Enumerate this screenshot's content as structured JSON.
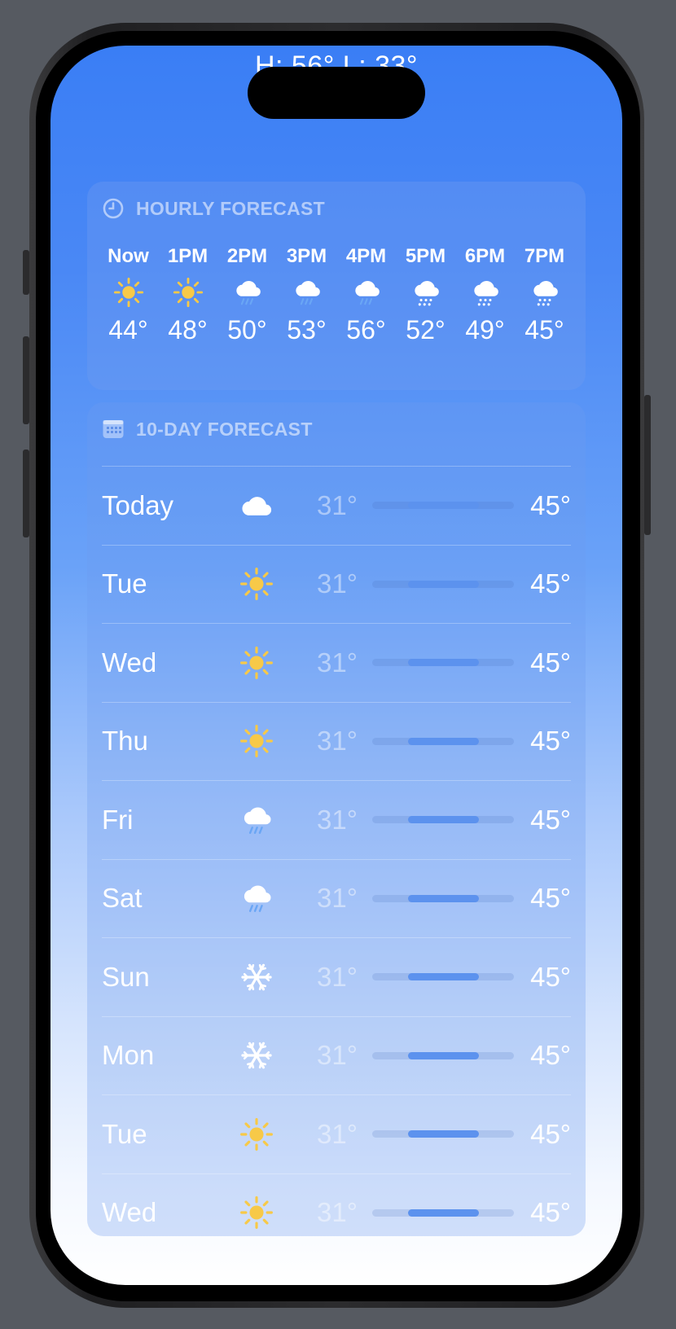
{
  "header": {
    "hi_lo_text": "H: 56°  L: 33°"
  },
  "hourly": {
    "title": "HOURLY FORECAST",
    "items": [
      {
        "time": "Now",
        "icon": "sun-icon",
        "temp": "44°"
      },
      {
        "time": "1PM",
        "icon": "sun-icon",
        "temp": "48°"
      },
      {
        "time": "2PM",
        "icon": "cloud-rain-icon",
        "temp": "50°"
      },
      {
        "time": "3PM",
        "icon": "cloud-rain-icon",
        "temp": "53°"
      },
      {
        "time": "4PM",
        "icon": "cloud-rain-icon",
        "temp": "56°"
      },
      {
        "time": "5PM",
        "icon": "cloud-snow-icon",
        "temp": "52°"
      },
      {
        "time": "6PM",
        "icon": "cloud-snow-icon",
        "temp": "49°"
      },
      {
        "time": "7PM",
        "icon": "cloud-snow-icon",
        "temp": "45°"
      }
    ]
  },
  "daily": {
    "title": "10-DAY FORECAST",
    "range_fill": {
      "start": 0.25,
      "end": 0.75
    },
    "items": [
      {
        "day": "Today",
        "icon": "cloud-icon",
        "low": "31°",
        "high": "45°"
      },
      {
        "day": "Tue",
        "icon": "sun-icon",
        "low": "31°",
        "high": "45°"
      },
      {
        "day": "Wed",
        "icon": "sun-icon",
        "low": "31°",
        "high": "45°"
      },
      {
        "day": "Thu",
        "icon": "sun-icon",
        "low": "31°",
        "high": "45°"
      },
      {
        "day": "Fri",
        "icon": "cloud-rain-icon",
        "low": "31°",
        "high": "45°"
      },
      {
        "day": "Sat",
        "icon": "cloud-rain-icon",
        "low": "31°",
        "high": "45°"
      },
      {
        "day": "Sun",
        "icon": "snowflake-icon",
        "low": "31°",
        "high": "45°"
      },
      {
        "day": "Mon",
        "icon": "snowflake-icon",
        "low": "31°",
        "high": "45°"
      },
      {
        "day": "Tue",
        "icon": "sun-icon",
        "low": "31°",
        "high": "45°"
      },
      {
        "day": "Wed",
        "icon": "sun-icon",
        "low": "31°",
        "high": "45°"
      }
    ]
  },
  "colors": {
    "sun": "#f7c948",
    "bar_fill": "#5c92ee",
    "rain": "#6aa6f5"
  }
}
